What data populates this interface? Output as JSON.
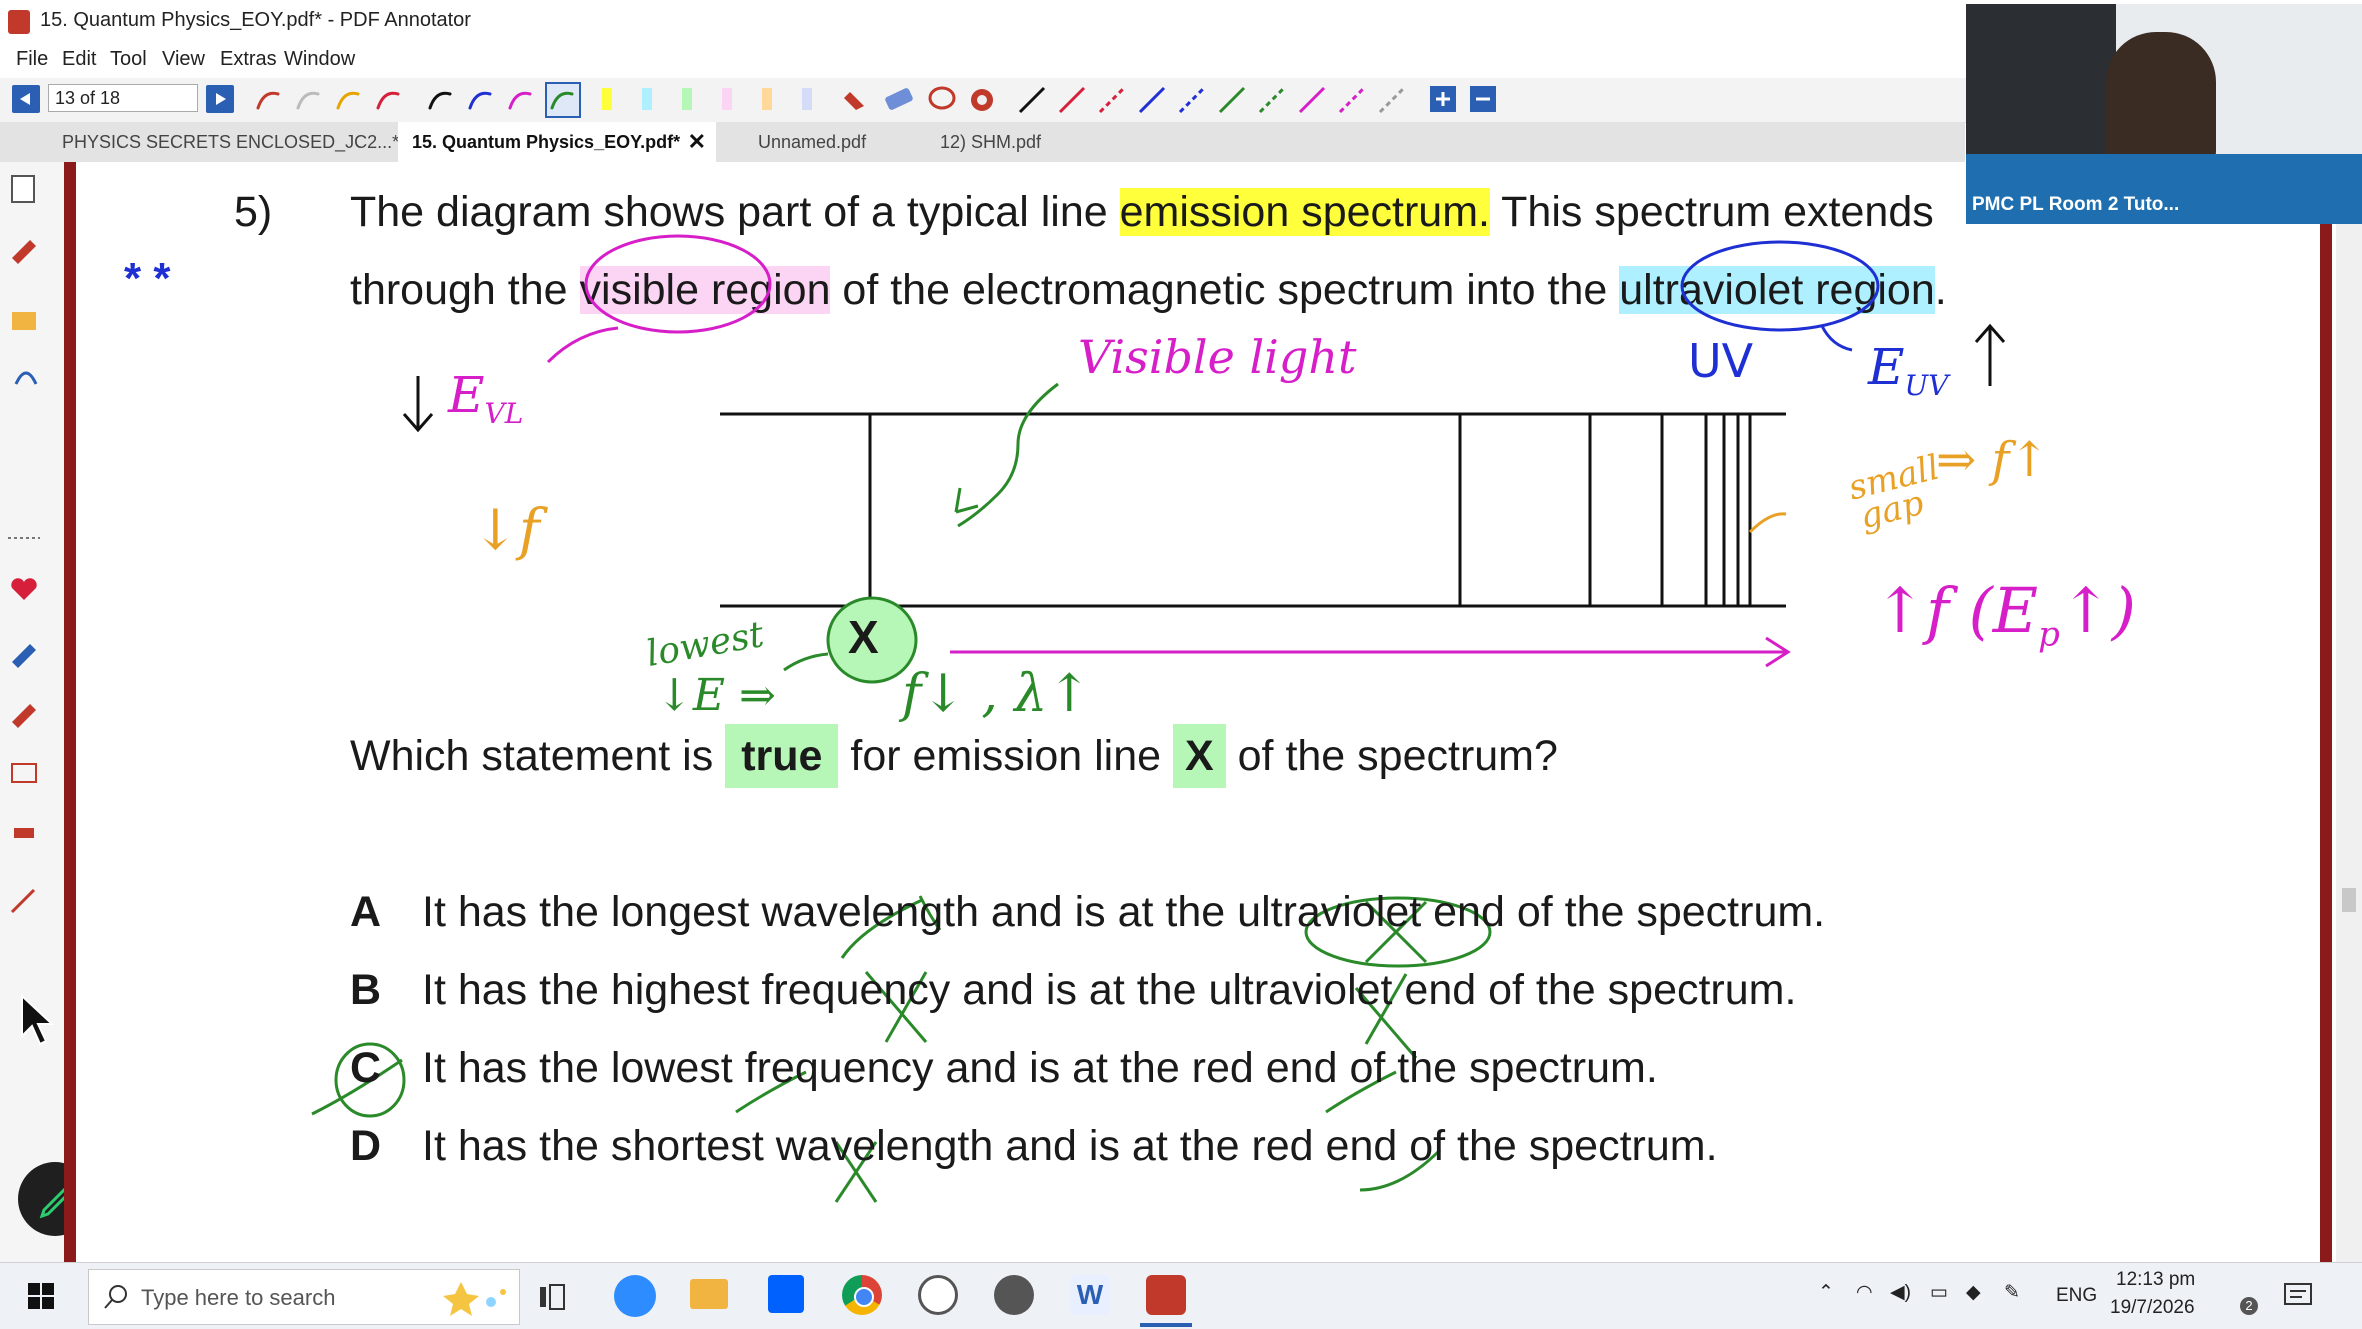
{
  "window": {
    "title": "15. Quantum Physics_EOY.pdf* - PDF Annotator"
  },
  "menu": [
    "File",
    "Edit",
    "Tool",
    "View",
    "Extras",
    "Window"
  ],
  "toolbar": {
    "page_value": "13 of 18"
  },
  "tabs": [
    {
      "label": "PHYSICS SECRETS ENCLOSED_JC2...*",
      "active": false
    },
    {
      "label": "15. Quantum Physics_EOY.pdf*",
      "active": true
    },
    {
      "label": "Unnamed.pdf",
      "active": false
    },
    {
      "label": "12) SHM.pdf",
      "active": false
    }
  ],
  "question": {
    "number": "5)",
    "line1_a": "The diagram shows part of a typical line ",
    "line1_hl": "emission spectrum.",
    "line1_b": " This spectrum extends",
    "line2_a": "through the ",
    "line2_hl1": "visible region",
    "line2_b": " of the electromagnetic spectrum into the ",
    "line2_hl2": "ultraviolet region",
    "line2_c": ".",
    "label_x": "X",
    "prompt_a": "Which statement is ",
    "prompt_true": "true",
    "prompt_b": " for emission line ",
    "prompt_x": "X",
    "prompt_c": " of the spectrum?",
    "options": [
      {
        "letter": "A",
        "text": "It has the longest wavelength and is at the ultraviolet end of the spectrum."
      },
      {
        "letter": "B",
        "text": "It has the highest frequency and is at the ultraviolet end of the spectrum."
      },
      {
        "letter": "C",
        "text": "It has the lowest frequency and is at the red end of the spectrum."
      },
      {
        "letter": "D",
        "text": "It has the shortest wavelength and is at the red end of the spectrum."
      }
    ]
  },
  "annotations": {
    "visible_light": "Visible light",
    "uv": "UV",
    "e_vl": "E",
    "e_vl_sub": "VL",
    "e_uv": "E",
    "e_uv_sub": "UV",
    "down_f": "↓f",
    "small_gap": "small",
    "small_gap2": "gap",
    "f_up": "⇒ f↑",
    "up_f": "↑f (E",
    "up_f_sub": "p",
    "up_f_end": "↑)",
    "lowest": "lowest",
    "lowest_e": "↓E ⇒",
    "f_lambda": "f↓ , λ↑",
    "stars": "* *"
  },
  "video": {
    "label": "PMC PL Room 2 Tuto..."
  },
  "taskbar": {
    "search_placeholder": "Type here to search",
    "lang": "ENG",
    "time": "12:13 pm",
    "date": "19/7/2026",
    "badge": "2"
  },
  "colors": {
    "accent_blue": "#2b5fb3",
    "rail": "#8b1a1a",
    "green_ink": "#2a8a2a",
    "pink_ink": "#d61fc8",
    "orange_ink": "#e8a025",
    "blue_ink": "#1e2fd4"
  }
}
